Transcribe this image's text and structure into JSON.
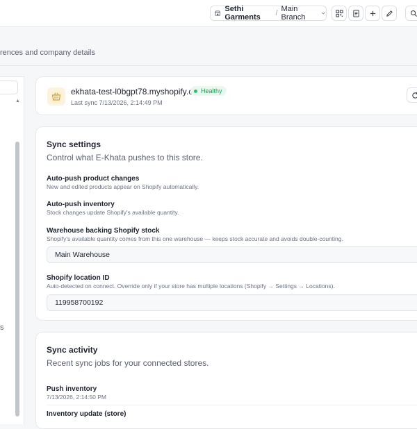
{
  "header": {
    "company": "Sethi Garments",
    "separator": "/",
    "branch": "Main Branch",
    "subtitle": "rences and company details"
  },
  "left_panel": {
    "fragment_char": "s"
  },
  "store": {
    "domain": "ekhata-test-l0bgpt78.myshopify.com",
    "status": "Healthy",
    "last_sync": "Last sync 7/13/2026, 2:14:49 PM"
  },
  "sync_settings": {
    "title": "Sync settings",
    "description": "Control what E-Khata pushes to this store.",
    "auto_push_products": {
      "label": "Auto-push product changes",
      "help": "New and edited products appear on Shopify automatically."
    },
    "auto_push_inventory": {
      "label": "Auto-push inventory",
      "help": "Stock changes update Shopify's available quantity."
    },
    "warehouse": {
      "label": "Warehouse backing Shopify stock",
      "help": "Shopify's available quantity comes from this one warehouse — keeps stock accurate and avoids double-counting.",
      "value": "Main Warehouse"
    },
    "location": {
      "label": "Shopify location ID",
      "help": "Auto-detected on connect. Override only if your store has multiple locations (Shopify → Settings → Locations).",
      "value": "119958700192"
    }
  },
  "sync_activity": {
    "title": "Sync activity",
    "description": "Recent sync jobs for your connected stores.",
    "items": [
      {
        "title": "Push inventory",
        "time": "7/13/2026, 2:14:50 PM"
      },
      {
        "title": "Inventory update (store)",
        "time": ""
      }
    ]
  },
  "colors": {
    "accent_healthy": "#1f9d55",
    "store_logo_bg": "#fdf3dc",
    "store_logo_fg": "#d69e2e"
  }
}
